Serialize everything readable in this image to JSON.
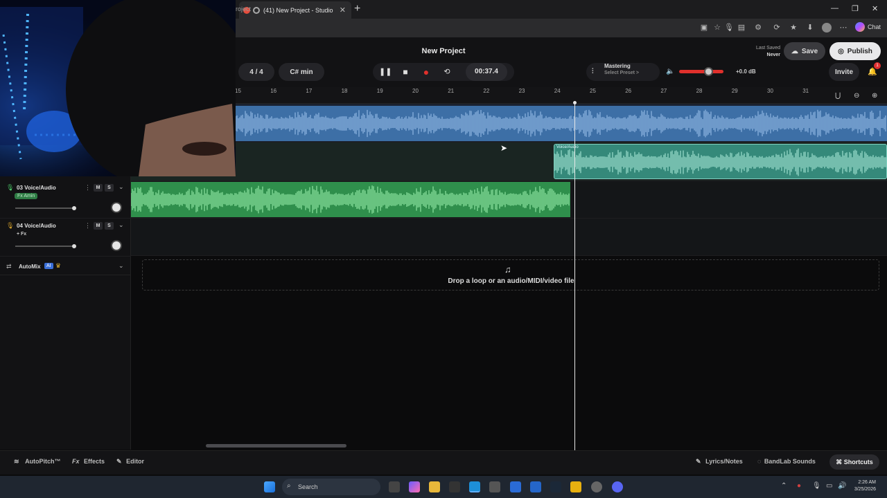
{
  "browser": {
    "tab_title": "(41) New Project - Studio",
    "url_fragment": "roject",
    "chat_label": "Chat"
  },
  "header": {
    "project_title": "New Project",
    "last_saved_label": "Last Saved",
    "last_saved_value": "Never",
    "save_label": "Save",
    "publish_label": "Publish",
    "invite_label": "Invite",
    "notification_count": "1"
  },
  "transport": {
    "time_signature": "4 / 4",
    "key": "C# min",
    "time": "00:37.4"
  },
  "mastering": {
    "label": "Mastering",
    "preset": "Select Preset >"
  },
  "volume": {
    "db": "+0.0 dB"
  },
  "ruler": {
    "bars": [
      "15",
      "16",
      "17",
      "18",
      "19",
      "20",
      "21",
      "22",
      "23",
      "24",
      "25",
      "26",
      "27",
      "28",
      "29",
      "30",
      "31"
    ]
  },
  "tracks": [
    {
      "name": "03 Voice/Audio",
      "fx": "Fx Amin",
      "m": "M",
      "s": "S"
    },
    {
      "name": "04 Voice/Audio",
      "fx": "+ Fx",
      "m": "M",
      "s": "S"
    }
  ],
  "clips": {
    "voice_clip_label": "Voice/Audio"
  },
  "automix": {
    "label": "AutoMix",
    "badge": "AI"
  },
  "dropzone": {
    "text": "Drop a loop or an audio/MIDI/video file"
  },
  "bottom": {
    "autopitch": "AutoPitch™",
    "effects": "Effects",
    "editor": "Editor",
    "lyrics": "Lyrics/Notes",
    "sounds": "BandLab Sounds",
    "shortcuts": "Shortcuts"
  },
  "taskbar": {
    "search_placeholder": "Search",
    "time": "2:26 AM",
    "date": "3/25/2026"
  },
  "colors": {
    "track_blue": "#4a7fb8",
    "track_teal": "#3f9e8c",
    "track_green": "#3da85a",
    "record_red": "#e0302c"
  }
}
